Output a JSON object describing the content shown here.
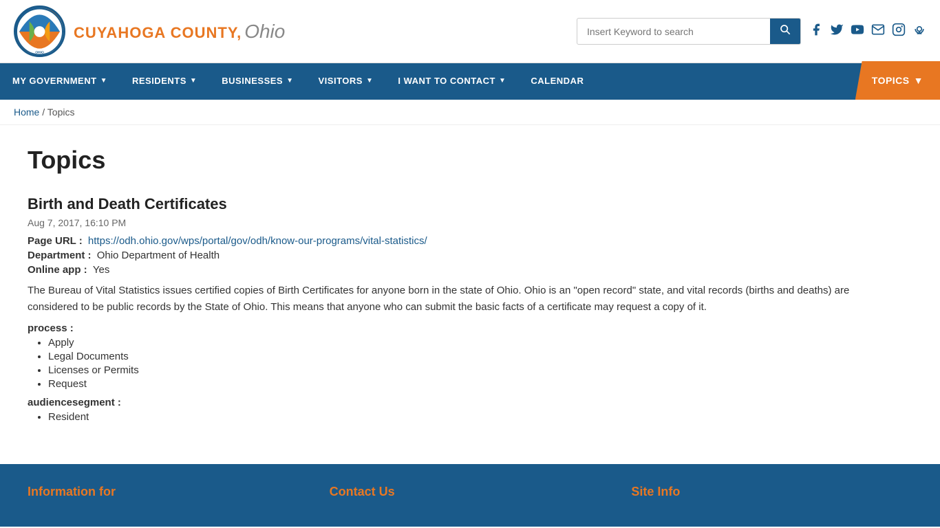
{
  "header": {
    "logo_alt": "Cuyahoga County Ohio",
    "county_name": "CUYAHOGA COUNTY,",
    "ohio_text": "Ohio",
    "search_placeholder": "Insert Keyword to search",
    "search_button_label": "🔍"
  },
  "social": [
    {
      "name": "facebook-icon",
      "symbol": "f"
    },
    {
      "name": "twitter-icon",
      "symbol": "t"
    },
    {
      "name": "youtube-icon",
      "symbol": "▶"
    },
    {
      "name": "email-icon",
      "symbol": "✉"
    },
    {
      "name": "instagram-icon",
      "symbol": "📷"
    },
    {
      "name": "podcast-icon",
      "symbol": "🎙"
    }
  ],
  "nav": {
    "items": [
      {
        "label": "MY GOVERNMENT",
        "has_arrow": true
      },
      {
        "label": "RESIDENTS",
        "has_arrow": true
      },
      {
        "label": "BUSINESSES",
        "has_arrow": true
      },
      {
        "label": "VISITORS",
        "has_arrow": true
      },
      {
        "label": "I WANT TO CONTACT",
        "has_arrow": true
      },
      {
        "label": "CALENDAR",
        "has_arrow": false
      }
    ],
    "topics_label": "TOPICS"
  },
  "breadcrumb": {
    "home_label": "Home",
    "separator": "/",
    "current": "Topics"
  },
  "page": {
    "title": "Topics",
    "article": {
      "title": "Birth and Death Certificates",
      "date": "Aug 7, 2017, 16:10 PM",
      "page_url_label": "Page URL :",
      "page_url": "https://odh.ohio.gov/wps/portal/gov/odh/know-our-programs/vital-statistics/",
      "department_label": "Department :",
      "department": "Ohio Department of Health",
      "online_app_label": "Online app :",
      "online_app": "Yes",
      "description": "The Bureau of Vital Statistics issues certified copies of Birth Certificates for anyone born in the state of Ohio. Ohio is an \"open record\" state, and vital records (births and deaths) are considered to be public records by the State of Ohio. This means that anyone who can submit the basic facts of a certificate may request a copy of it.",
      "process_label": "process :",
      "process_items": [
        "Apply",
        "Legal Documents",
        "Licenses or Permits",
        "Request"
      ],
      "audience_label": "audiencesegment :",
      "audience_items": [
        "Resident"
      ]
    }
  },
  "footer": {
    "col1_title": "Information for",
    "col2_title": "Contact Us",
    "col3_title": "Site Info"
  }
}
